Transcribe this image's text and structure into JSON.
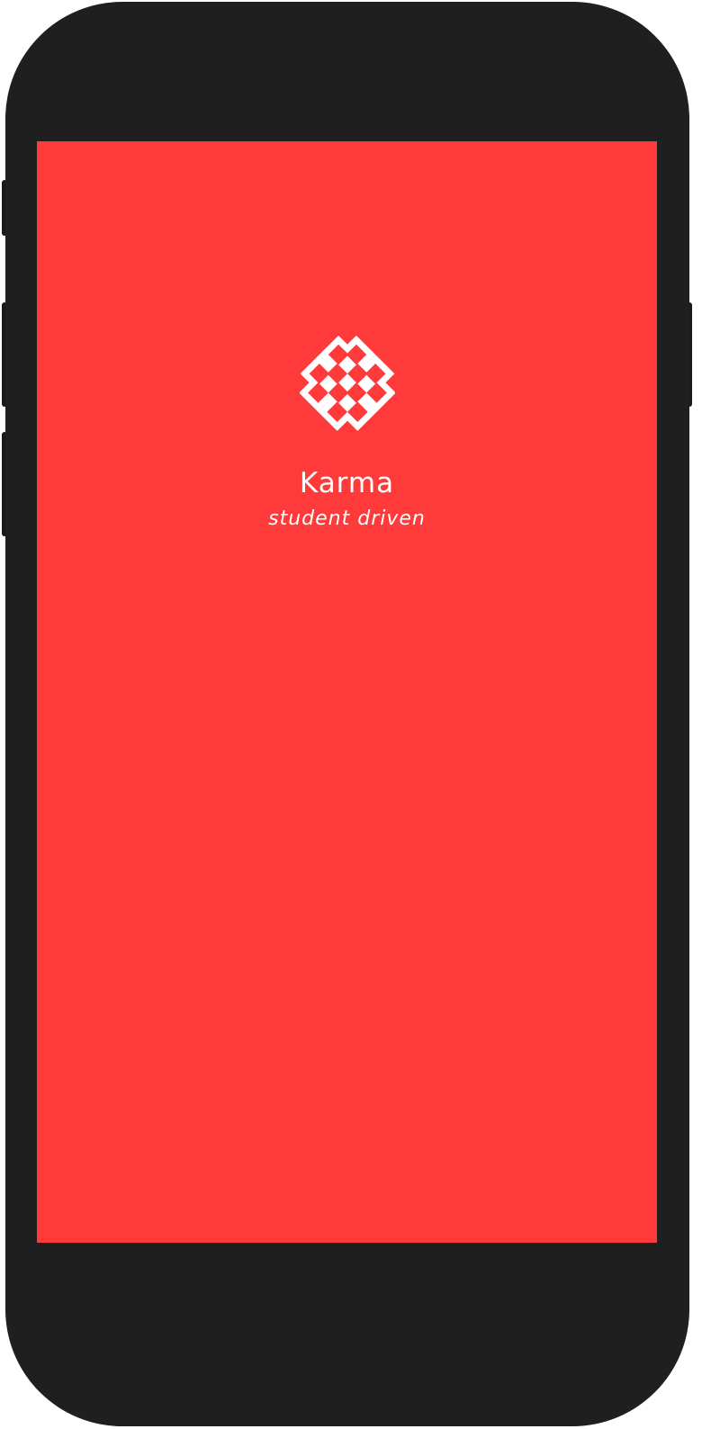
{
  "colors": {
    "device_body": "#1f1f1f",
    "screen_background": "#ff3a3a",
    "foreground": "#ffffff"
  },
  "splash": {
    "logo_icon": "endless-knot-icon",
    "app_name": "Karma",
    "tagline": "student driven"
  }
}
